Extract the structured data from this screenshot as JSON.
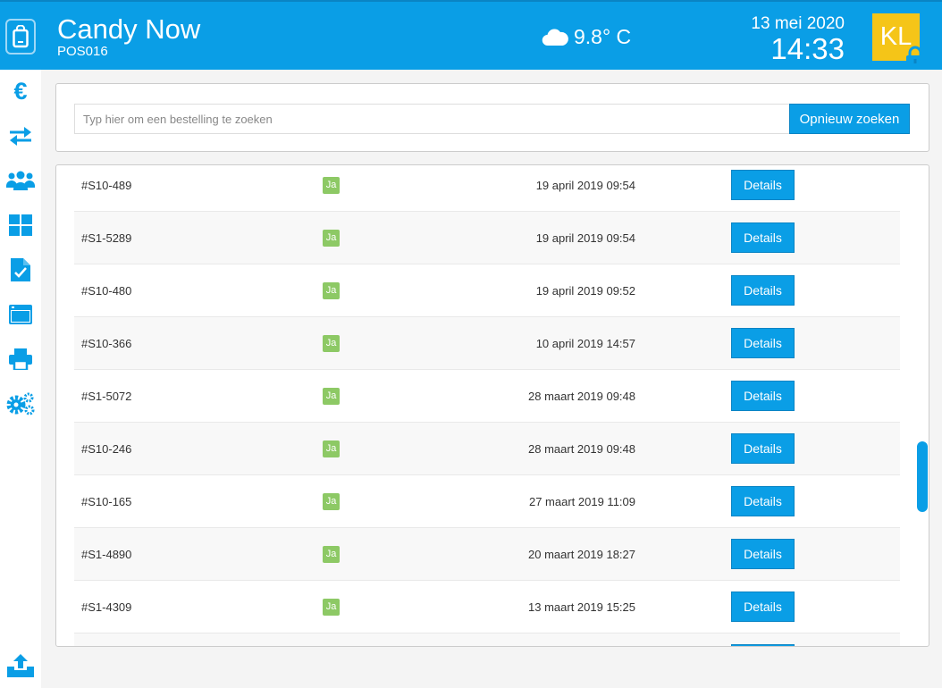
{
  "header": {
    "app_name": "Candy Now",
    "pos_id": "POS016",
    "weather": "9.8° C",
    "date": "13 mei 2020",
    "time": "14:33",
    "user_initials": "KL",
    "brand_color": "#0a9ee6",
    "avatar_color": "#f5c518"
  },
  "sidebar": {
    "items": [
      {
        "name": "euro-icon",
        "label": "€"
      },
      {
        "name": "transfer-arrows-icon"
      },
      {
        "name": "customers-icon"
      },
      {
        "name": "dashboard-grid-icon"
      },
      {
        "name": "clipboard-check-icon"
      },
      {
        "name": "window-icon"
      },
      {
        "name": "printer-icon"
      },
      {
        "name": "settings-gears-icon"
      }
    ],
    "bottom_item": {
      "name": "upload-icon"
    }
  },
  "search": {
    "placeholder": "Typ hier om een bestelling te zoeken",
    "value": "",
    "button_label": "Opnieuw zoeken"
  },
  "orders": {
    "rows": [
      {
        "id": "#S10-489",
        "badge": "Ja",
        "date": "19 april 2019 09:54",
        "action": "Details"
      },
      {
        "id": "#S1-5289",
        "badge": "Ja",
        "date": "19 april 2019 09:54",
        "action": "Details"
      },
      {
        "id": "#S10-480",
        "badge": "Ja",
        "date": "19 april 2019 09:52",
        "action": "Details"
      },
      {
        "id": "#S10-366",
        "badge": "Ja",
        "date": "10 april 2019 14:57",
        "action": "Details"
      },
      {
        "id": "#S1-5072",
        "badge": "Ja",
        "date": "28 maart 2019 09:48",
        "action": "Details"
      },
      {
        "id": "#S10-246",
        "badge": "Ja",
        "date": "28 maart 2019 09:48",
        "action": "Details"
      },
      {
        "id": "#S10-165",
        "badge": "Ja",
        "date": "27 maart 2019 11:09",
        "action": "Details"
      },
      {
        "id": "#S1-4890",
        "badge": "Ja",
        "date": "20 maart 2019 18:27",
        "action": "Details"
      },
      {
        "id": "#S1-4309",
        "badge": "Ja",
        "date": "13 maart 2019 15:25",
        "action": "Details"
      },
      {
        "id": "",
        "badge": "",
        "date": "",
        "action": ""
      }
    ]
  }
}
